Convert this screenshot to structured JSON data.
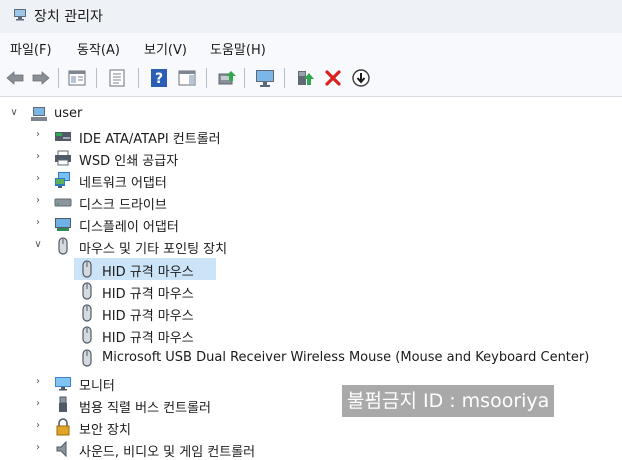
{
  "window": {
    "title": "장치 관리자"
  },
  "menu": [
    {
      "label": "파일",
      "key": "(F)"
    },
    {
      "label": "동작",
      "key": "(A)"
    },
    {
      "label": "보기",
      "key": "(V)"
    },
    {
      "label": "도움말",
      "key": "(H)"
    }
  ],
  "toolbar": {
    "icons": [
      "back-icon",
      "forward-icon",
      "properties-icon",
      "show-hide-icon",
      "help-icon",
      "action-pane-icon",
      "update-driver-icon",
      "scan-hardware-icon",
      "enable-device-icon",
      "uninstall-icon",
      "download-icon"
    ]
  },
  "tree": {
    "root": "user",
    "categories": [
      {
        "label": "IDE ATA/ATAPI 컨트롤러",
        "icon": "ide-controller-icon"
      },
      {
        "label": "WSD 인쇄 공급자",
        "icon": "printer-icon"
      },
      {
        "label": "네트워크 어댑터",
        "icon": "network-adapter-icon"
      },
      {
        "label": "디스크 드라이브",
        "icon": "disk-drive-icon"
      },
      {
        "label": "디스플레이 어댑터",
        "icon": "display-adapter-icon"
      },
      {
        "label": "마우스 및 기타 포인팅 장치",
        "icon": "mouse-icon",
        "expanded": true
      },
      {
        "label": "모니터",
        "icon": "monitor-icon"
      },
      {
        "label": "범용 직렬 버스 컨트롤러",
        "icon": "usb-icon"
      },
      {
        "label": "보안 장치",
        "icon": "security-icon"
      },
      {
        "label": "사운드, 비디오 및 게임 컨트롤러",
        "icon": "sound-icon"
      }
    ],
    "mouse_children": [
      "HID 규격 마우스",
      "HID 규격 마우스",
      "HID 규격 마우스",
      "HID 규격 마우스",
      "Microsoft USB Dual Receiver Wireless Mouse (Mouse and Keyboard Center)"
    ],
    "selected_child_index": 0
  },
  "watermark": "불펌금지 ID : msooriya"
}
